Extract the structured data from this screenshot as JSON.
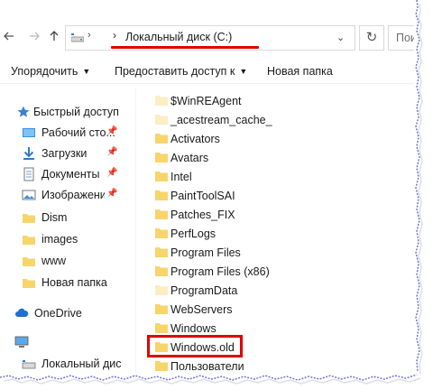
{
  "address_bar": {
    "back_icon": "arrow-left-icon",
    "forward_icon": "arrow-right-icon",
    "up_icon": "arrow-up-icon",
    "path": "Локальный диск (C:)",
    "refresh_icon": "refresh-icon",
    "search_placeholder": "Поис"
  },
  "command_bar": {
    "sort_label": "Упорядочить",
    "share_label": "Предоставить доступ к",
    "new_folder_label": "Новая папка"
  },
  "nav_pane": {
    "items": [
      {
        "label": "Быстрый доступ",
        "icon": "star-icon"
      },
      {
        "label": "Рабочий сто...",
        "icon": "desktop-folder-icon",
        "pinned": true
      },
      {
        "label": "Загрузки",
        "icon": "download-icon",
        "pinned": true
      },
      {
        "label": "Документы",
        "icon": "documents-icon",
        "pinned": true
      },
      {
        "label": "Изображени",
        "icon": "pictures-icon",
        "pinned": true
      },
      {
        "label": "Dism",
        "icon": "folder-icon"
      },
      {
        "label": "images",
        "icon": "folder-icon"
      },
      {
        "label": "www",
        "icon": "folder-icon"
      },
      {
        "label": "Новая папка",
        "icon": "folder-icon"
      },
      {
        "label": "OneDrive",
        "icon": "cloud-icon"
      },
      {
        "label": "",
        "icon": "computer-icon"
      },
      {
        "label": "Локальный дис",
        "icon": "drive-icon"
      }
    ]
  },
  "files": [
    "$WinREAgent",
    "_acestream_cache_",
    "Activators",
    "Avatars",
    "Intel",
    "PaintToolSAI",
    "Patches_FIX",
    "PerfLogs",
    "Program Files",
    "Program Files (x86)",
    "ProgramData",
    "WebServers",
    "Windows",
    "Windows.old",
    "Пользователи"
  ],
  "highlighted_file": "Windows.old",
  "colors": {
    "annotation_red": "#e00000",
    "folder_yellow": "#f7d56b",
    "folder_light": "#fbeec2",
    "edge_blue": "#6a6ad8"
  }
}
